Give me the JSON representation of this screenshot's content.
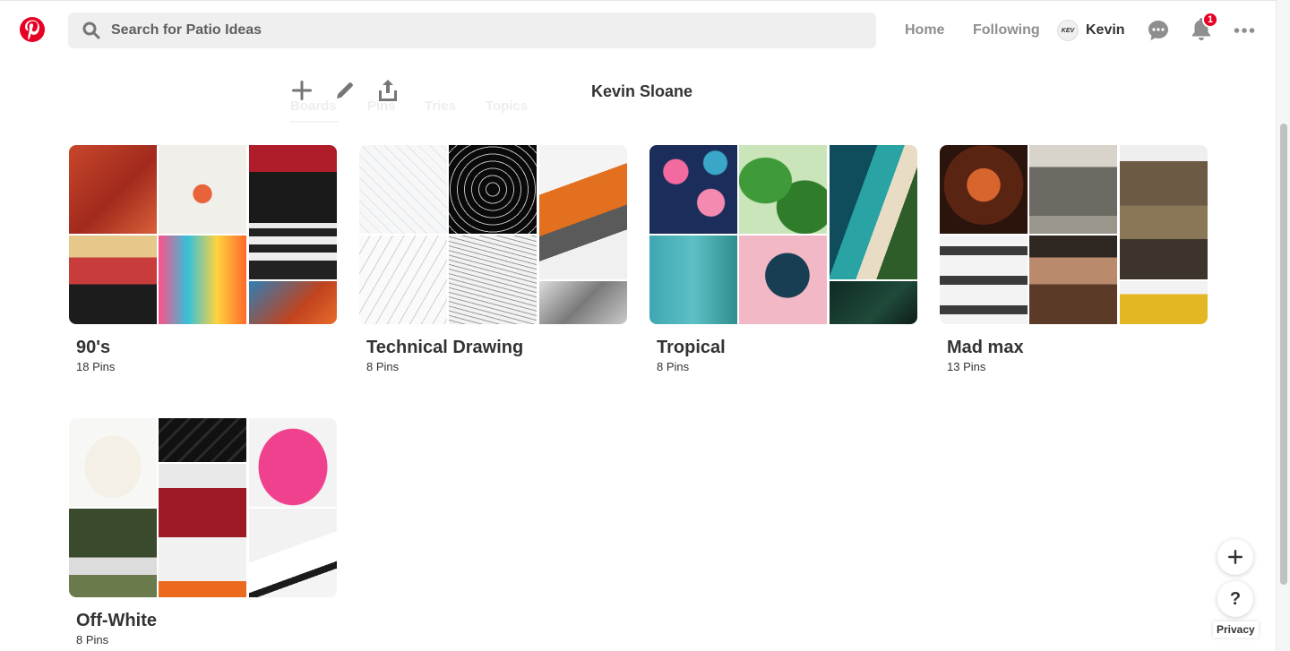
{
  "header": {
    "search_placeholder": "Search for Patio Ideas",
    "nav_home": "Home",
    "nav_following": "Following",
    "user_name": "Kevin",
    "notification_count": "1",
    "avatar_text": "KEV"
  },
  "profile": {
    "name": "Kevin Sloane",
    "tabs": [
      "Boards",
      "Pins",
      "Tries",
      "Topics"
    ]
  },
  "boards": [
    {
      "title": "90's",
      "count": "18 Pins"
    },
    {
      "title": "Technical Drawing",
      "count": "8 Pins"
    },
    {
      "title": "Tropical",
      "count": "8 Pins"
    },
    {
      "title": "Mad max",
      "count": "13 Pins"
    },
    {
      "title": "Off-White",
      "count": "8 Pins"
    }
  ],
  "footer": {
    "privacy": "Privacy",
    "help": "?"
  },
  "colors": {
    "brand_red": "#e60023",
    "search_bg": "#efefef"
  }
}
